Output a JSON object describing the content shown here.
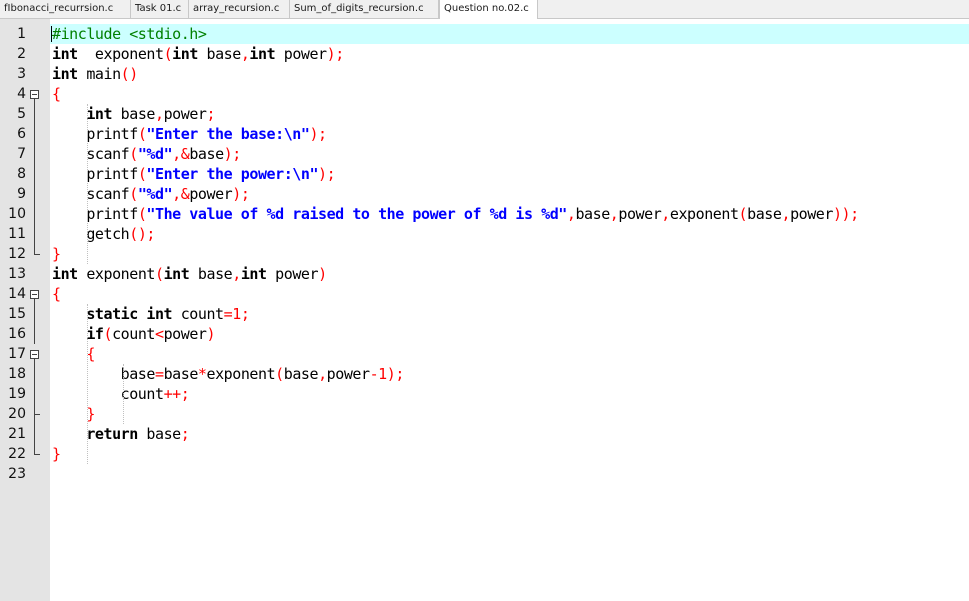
{
  "tabs": [
    {
      "label": "fIbonacci_recurrsion.c",
      "active": false
    },
    {
      "label": "Task 01.c",
      "active": false
    },
    {
      "label": "array_recursion.c",
      "active": false
    },
    {
      "label": "Sum_of_digits_recursion.c",
      "active": false
    },
    {
      "label": "Question no.02.c",
      "active": true
    }
  ],
  "colors": {
    "keyword": "#000000",
    "preprocessor": "#008000",
    "string": "#0000ff",
    "operator": "#ff0000",
    "current_line": "#ccffff",
    "gutter": "#e4e4e4"
  },
  "editor": {
    "current_line": 1,
    "lines": [
      {
        "n": "1",
        "fold": "",
        "tokens": [
          [
            "pp",
            "#include <stdio.h>"
          ]
        ]
      },
      {
        "n": "2",
        "fold": "",
        "tokens": [
          [
            "kw",
            "int"
          ],
          [
            "",
            "  exponent"
          ],
          [
            "br",
            "("
          ],
          [
            "kw",
            "int"
          ],
          [
            "",
            " base"
          ],
          [
            "op",
            ","
          ],
          [
            "kw",
            "int"
          ],
          [
            "",
            " power"
          ],
          [
            "br",
            ")"
          ],
          [
            "op",
            ";"
          ]
        ]
      },
      {
        "n": "3",
        "fold": "",
        "tokens": [
          [
            "kw",
            "int"
          ],
          [
            "",
            " main"
          ],
          [
            "br",
            "()"
          ]
        ]
      },
      {
        "n": "4",
        "fold": "open",
        "tokens": [
          [
            "br",
            "{"
          ]
        ]
      },
      {
        "n": "5",
        "fold": "mid",
        "tokens": [
          [
            "",
            "    "
          ],
          [
            "kw",
            "int"
          ],
          [
            "",
            " base"
          ],
          [
            "op",
            ","
          ],
          [
            "",
            "power"
          ],
          [
            "op",
            ";"
          ]
        ]
      },
      {
        "n": "6",
        "fold": "mid",
        "tokens": [
          [
            "",
            "    printf"
          ],
          [
            "br",
            "("
          ],
          [
            "str",
            "\"Enter the base:\\n\""
          ],
          [
            "br",
            ")"
          ],
          [
            "op",
            ";"
          ]
        ]
      },
      {
        "n": "7",
        "fold": "mid",
        "tokens": [
          [
            "",
            "    scanf"
          ],
          [
            "br",
            "("
          ],
          [
            "str",
            "\"%d\""
          ],
          [
            "op",
            ",&"
          ],
          [
            "",
            "base"
          ],
          [
            "br",
            ")"
          ],
          [
            "op",
            ";"
          ]
        ]
      },
      {
        "n": "8",
        "fold": "mid",
        "tokens": [
          [
            "",
            "    printf"
          ],
          [
            "br",
            "("
          ],
          [
            "str",
            "\"Enter the power:\\n\""
          ],
          [
            "br",
            ")"
          ],
          [
            "op",
            ";"
          ]
        ]
      },
      {
        "n": "9",
        "fold": "mid",
        "tokens": [
          [
            "",
            "    scanf"
          ],
          [
            "br",
            "("
          ],
          [
            "str",
            "\"%d\""
          ],
          [
            "op",
            ",&"
          ],
          [
            "",
            "power"
          ],
          [
            "br",
            ")"
          ],
          [
            "op",
            ";"
          ]
        ]
      },
      {
        "n": "10",
        "fold": "mid",
        "tokens": [
          [
            "",
            "    printf"
          ],
          [
            "br",
            "("
          ],
          [
            "str",
            "\"The value of %d raised to the power of %d is %d\""
          ],
          [
            "op",
            ","
          ],
          [
            "",
            "base"
          ],
          [
            "op",
            ","
          ],
          [
            "",
            "power"
          ],
          [
            "op",
            ","
          ],
          [
            "",
            "exponent"
          ],
          [
            "br",
            "("
          ],
          [
            "",
            "base"
          ],
          [
            "op",
            ","
          ],
          [
            "",
            "power"
          ],
          [
            "br",
            "))"
          ],
          [
            "op",
            ";"
          ]
        ]
      },
      {
        "n": "11",
        "fold": "mid",
        "tokens": [
          [
            "",
            "    getch"
          ],
          [
            "br",
            "()"
          ],
          [
            "op",
            ";"
          ]
        ]
      },
      {
        "n": "12",
        "fold": "end",
        "tokens": [
          [
            "br",
            "}"
          ]
        ]
      },
      {
        "n": "13",
        "fold": "",
        "tokens": [
          [
            "kw",
            "int"
          ],
          [
            "",
            " exponent"
          ],
          [
            "br",
            "("
          ],
          [
            "kw",
            "int"
          ],
          [
            "",
            " base"
          ],
          [
            "op",
            ","
          ],
          [
            "kw",
            "int"
          ],
          [
            "",
            " power"
          ],
          [
            "br",
            ")"
          ]
        ]
      },
      {
        "n": "14",
        "fold": "open",
        "tokens": [
          [
            "br",
            "{"
          ]
        ]
      },
      {
        "n": "15",
        "fold": "mid",
        "tokens": [
          [
            "",
            "    "
          ],
          [
            "kw",
            "static int"
          ],
          [
            "",
            " count"
          ],
          [
            "op",
            "="
          ],
          [
            "num",
            "1"
          ],
          [
            "op",
            ";"
          ]
        ]
      },
      {
        "n": "16",
        "fold": "mid",
        "tokens": [
          [
            "",
            "    "
          ],
          [
            "kw",
            "if"
          ],
          [
            "br",
            "("
          ],
          [
            "",
            "count"
          ],
          [
            "op",
            "<"
          ],
          [
            "",
            "power"
          ],
          [
            "br",
            ")"
          ]
        ]
      },
      {
        "n": "17",
        "fold": "open",
        "tokens": [
          [
            "",
            "    "
          ],
          [
            "br",
            "{"
          ]
        ]
      },
      {
        "n": "18",
        "fold": "mid",
        "tokens": [
          [
            "",
            "        base"
          ],
          [
            "op",
            "="
          ],
          [
            "",
            "base"
          ],
          [
            "op",
            "*"
          ],
          [
            "",
            "exponent"
          ],
          [
            "br",
            "("
          ],
          [
            "",
            "base"
          ],
          [
            "op",
            ","
          ],
          [
            "",
            "power"
          ],
          [
            "op",
            "-"
          ],
          [
            "num",
            "1"
          ],
          [
            "br",
            ")"
          ],
          [
            "op",
            ";"
          ]
        ]
      },
      {
        "n": "19",
        "fold": "mid",
        "tokens": [
          [
            "",
            "        count"
          ],
          [
            "op",
            "++;"
          ]
        ]
      },
      {
        "n": "20",
        "fold": "end2",
        "tokens": [
          [
            "",
            "    "
          ],
          [
            "br",
            "}"
          ]
        ]
      },
      {
        "n": "21",
        "fold": "mid",
        "tokens": [
          [
            "",
            "    "
          ],
          [
            "kw",
            "return"
          ],
          [
            "",
            " base"
          ],
          [
            "op",
            ";"
          ]
        ]
      },
      {
        "n": "22",
        "fold": "end",
        "tokens": [
          [
            "br",
            "}"
          ]
        ]
      },
      {
        "n": "23",
        "fold": "",
        "tokens": []
      }
    ]
  }
}
